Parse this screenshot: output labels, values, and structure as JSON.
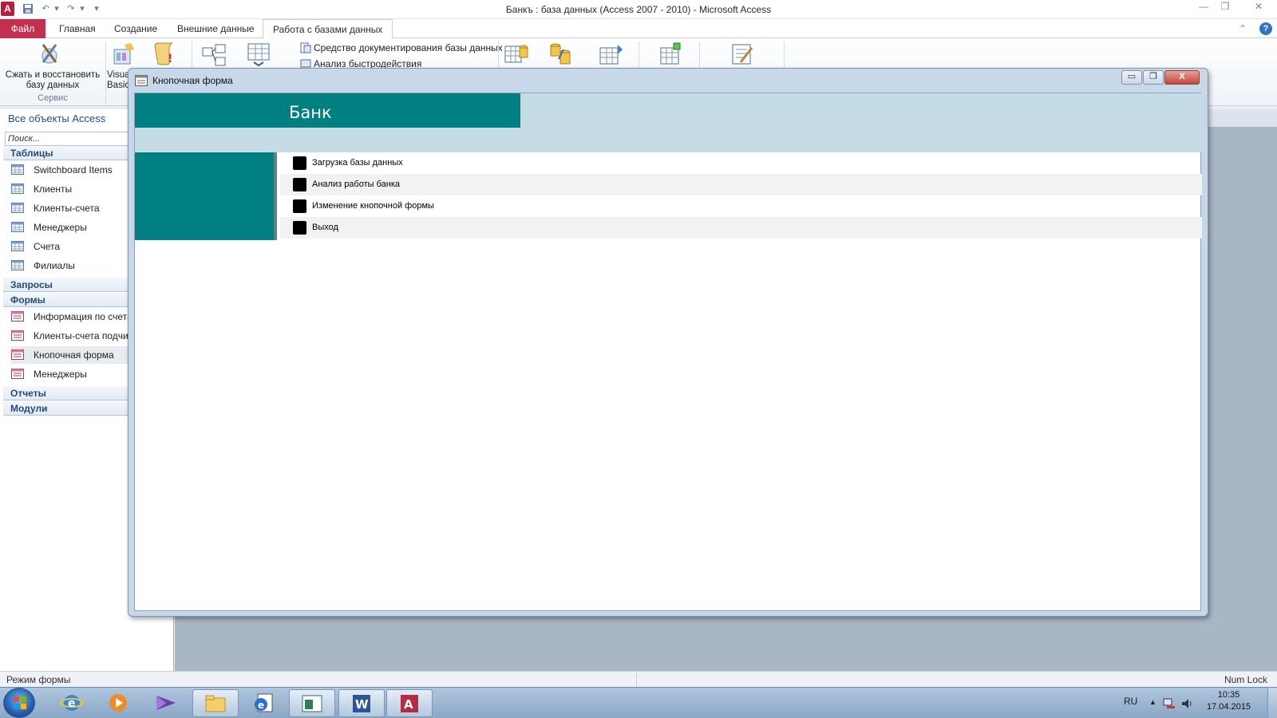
{
  "window": {
    "title": "Банкъ : база данных (Access 2007 - 2010)  -  Microsoft Access",
    "minimize": "—",
    "restore": "❐",
    "close": "✕",
    "app_icon_letter": "A"
  },
  "qat": {
    "save_icon": "floppy-icon",
    "undo_label": "↶",
    "redo_label": "↷",
    "customize_label": "▾"
  },
  "ribbon_tabs": {
    "file": "Файл",
    "home": "Главная",
    "create": "Создание",
    "external": "Внешние данные",
    "database_tools": "Работа с базами данных",
    "collapse_label": "⌃",
    "help_label": "?"
  },
  "ribbon": {
    "compact_label": "Сжать и восстановить базу данных",
    "visual_basic_label": "Visual Basic",
    "service_group": "Сервис",
    "documenter_label": "Средство документирования базы данных",
    "performance_label": "Анализ быстродействия"
  },
  "nav": {
    "header": "Все объекты Access",
    "search_placeholder": "Поиск...",
    "sections": {
      "tables": "Таблицы",
      "queries": "Запросы",
      "forms": "Формы",
      "reports": "Отчеты",
      "modules": "Модули"
    },
    "tables": [
      "Switchboard Items",
      "Клиенты",
      "Клиенты-счета",
      "Менеджеры",
      "Счета",
      "Филиалы"
    ],
    "forms": [
      "Информация по счетам",
      "Клиенты-счета подчиненная",
      "Кнопочная форма",
      "Менеджеры"
    ]
  },
  "form": {
    "window_title": "Кнопочная форма",
    "header_title": "Банк",
    "buttons": [
      "Загрузка базы данных",
      "Анализ работы банка",
      "Изменение кнопочной формы",
      "Выход"
    ],
    "win_min": "▭",
    "win_restore": "❐",
    "win_close": "X"
  },
  "status": {
    "mode": "Режим формы",
    "num_lock": "Num Lock"
  },
  "taskbar": {
    "lang": "RU",
    "tray_arrow": "▲",
    "time": "10:35",
    "date": "17.04.2015"
  },
  "colors": {
    "accent_file": "#c22f4f",
    "switchboard_teal": "#008080",
    "switchboard_band": "#c6dce4"
  }
}
